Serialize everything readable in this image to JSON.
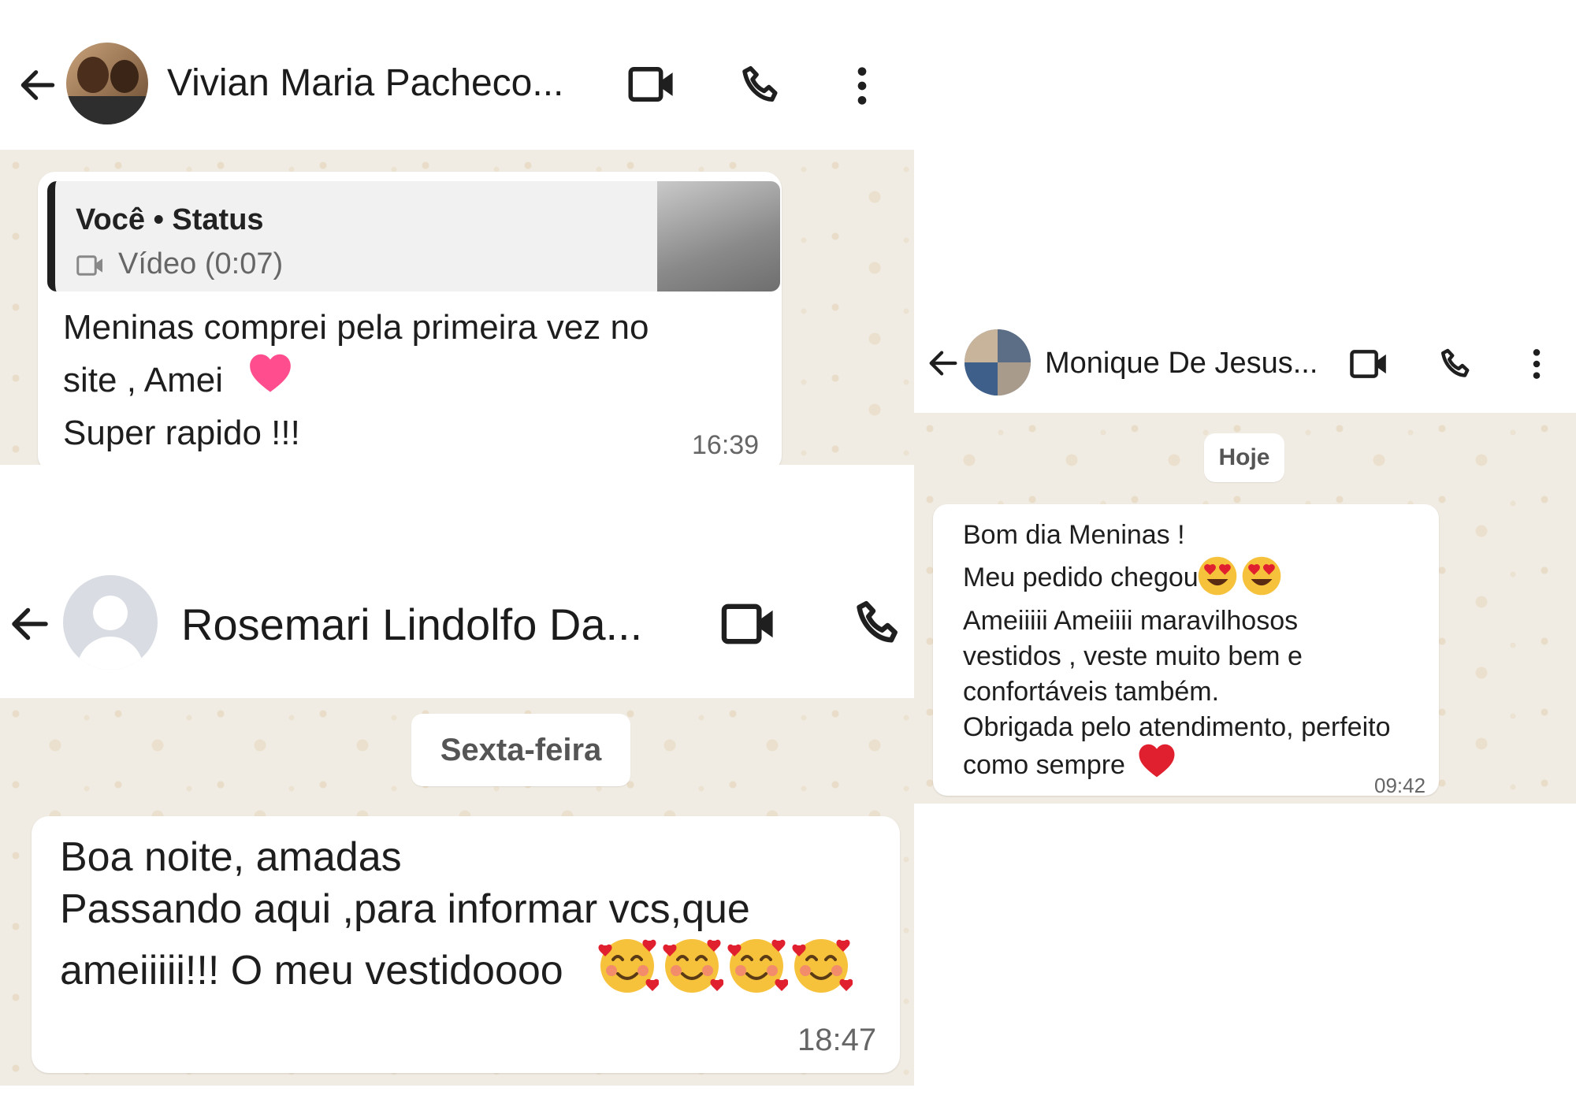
{
  "chat1": {
    "contact_name": "Vivian Maria Pacheco...",
    "reply": {
      "title": "Você • Status",
      "media_label": "Vídeo (0:07)"
    },
    "message": "Meninas comprei pela primeira vez no\nsite , Amei\nSuper rapido !!!",
    "time": "16:39"
  },
  "chat2": {
    "contact_name": "Rosemari Lindolfo Da...",
    "day_label": "Sexta-feira",
    "message_line1": "Boa noite, amadas",
    "message_line2": "Passando aqui ,para informar vcs,que",
    "message_line3": "ameiiiii!!! O meu vestidoooo",
    "time": "18:47"
  },
  "chat3": {
    "contact_name": "Monique De Jesus...",
    "day_label": "Hoje",
    "line1": "Bom dia Meninas !",
    "line2": "Meu pedido chegou",
    "line3": "Ameiiiii Ameiiii maravilhosos\nvestidos , veste muito bem e\nconfortáveis também.\nObrigada pelo atendimento, perfeito",
    "line4": "como sempre",
    "time": "09:42"
  },
  "icons": [
    "back-arrow-icon",
    "video-call-icon",
    "voice-call-icon",
    "more-options-icon",
    "heart-emoji-icon",
    "smiling-face-with-hearts-icon",
    "heart-eyes-emoji-icon",
    "video-icon"
  ],
  "colors": {
    "chat_background": "#f1ece3",
    "bubble": "#ffffff",
    "reply_bar": "#1f1f1f",
    "heart_pink": "#ff4d8d",
    "heart_red": "#e0202f"
  }
}
